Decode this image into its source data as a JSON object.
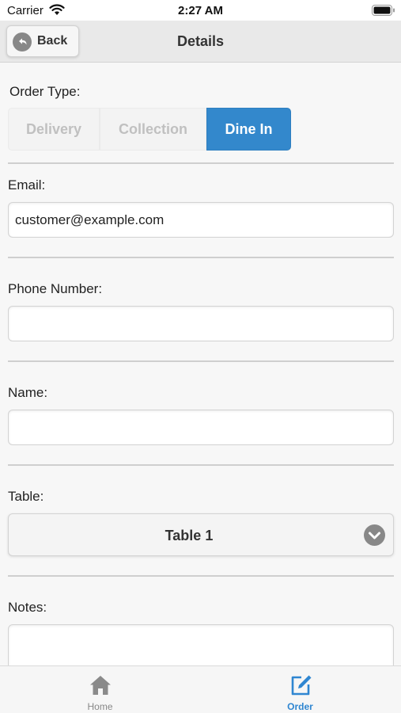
{
  "status_bar": {
    "carrier": "Carrier",
    "time": "2:27 AM"
  },
  "header": {
    "back_label": "Back",
    "title": "Details"
  },
  "form": {
    "order_type": {
      "label": "Order Type:",
      "options": [
        "Delivery",
        "Collection",
        "Dine In"
      ],
      "selected": "Dine In"
    },
    "email": {
      "label": "Email:",
      "value": "customer@example.com"
    },
    "phone": {
      "label": "Phone Number:",
      "value": ""
    },
    "name": {
      "label": "Name:",
      "value": ""
    },
    "table": {
      "label": "Table:",
      "value": "Table 1"
    },
    "notes": {
      "label": "Notes:",
      "value": ""
    }
  },
  "tab_bar": {
    "items": [
      {
        "label": "Home",
        "icon": "home-icon",
        "active": false
      },
      {
        "label": "Order",
        "icon": "edit-icon",
        "active": true
      }
    ]
  },
  "colors": {
    "accent": "#3388cc",
    "tab_active": "#2f86d1",
    "header_bg": "#e9e9e9",
    "page_bg": "#f7f7f7"
  }
}
